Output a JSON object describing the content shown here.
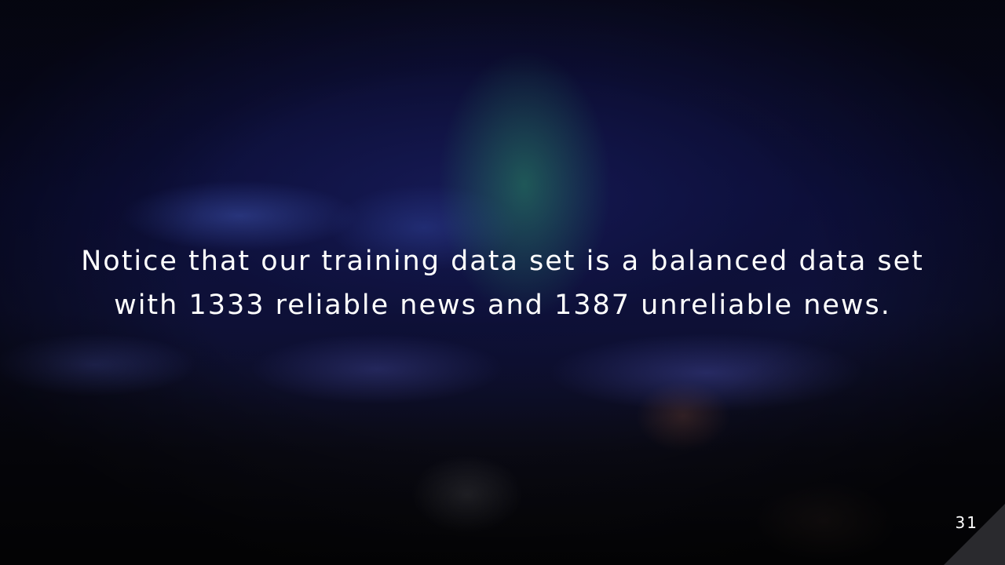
{
  "slide": {
    "text_line_1": "Notice that our training data set is a balanced data set",
    "text_line_2": "with 1333 reliable news and 1387 unreliable news.",
    "slide_number": "31"
  }
}
